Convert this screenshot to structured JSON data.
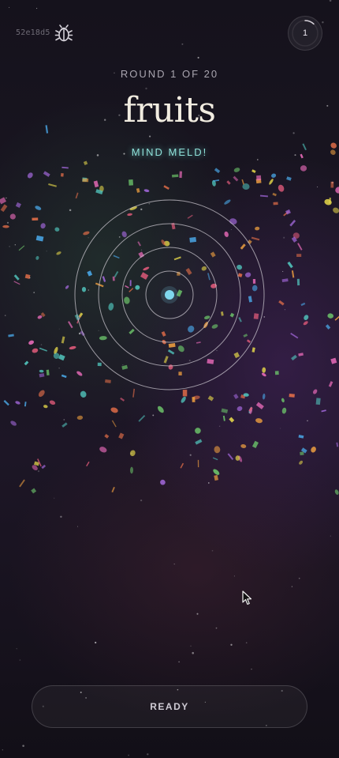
{
  "session": {
    "hash": "52e18d5"
  },
  "icons": {
    "debug": "bug-icon",
    "timer": "progress-ring-icon",
    "cursor": "mouse-pointer-icon"
  },
  "counter": {
    "value": "1",
    "progress": 0.12
  },
  "round": {
    "label": "ROUND 1 OF 20"
  },
  "prompt": {
    "word": "fruits"
  },
  "status": {
    "label": "MIND MELD!"
  },
  "radar": {
    "rings": 4,
    "center_color": "#7fd8ee",
    "ring_color": "#c8c4cc"
  },
  "actions": {
    "ready_label": "READY"
  },
  "colors": {
    "accent_glow": "#8ee0d8",
    "confetti": [
      "#e05a7a",
      "#f0a040",
      "#e6d84a",
      "#6cc46a",
      "#4aa8e8",
      "#a66ae0",
      "#e86ab8",
      "#e8704a",
      "#52c9c0"
    ]
  }
}
